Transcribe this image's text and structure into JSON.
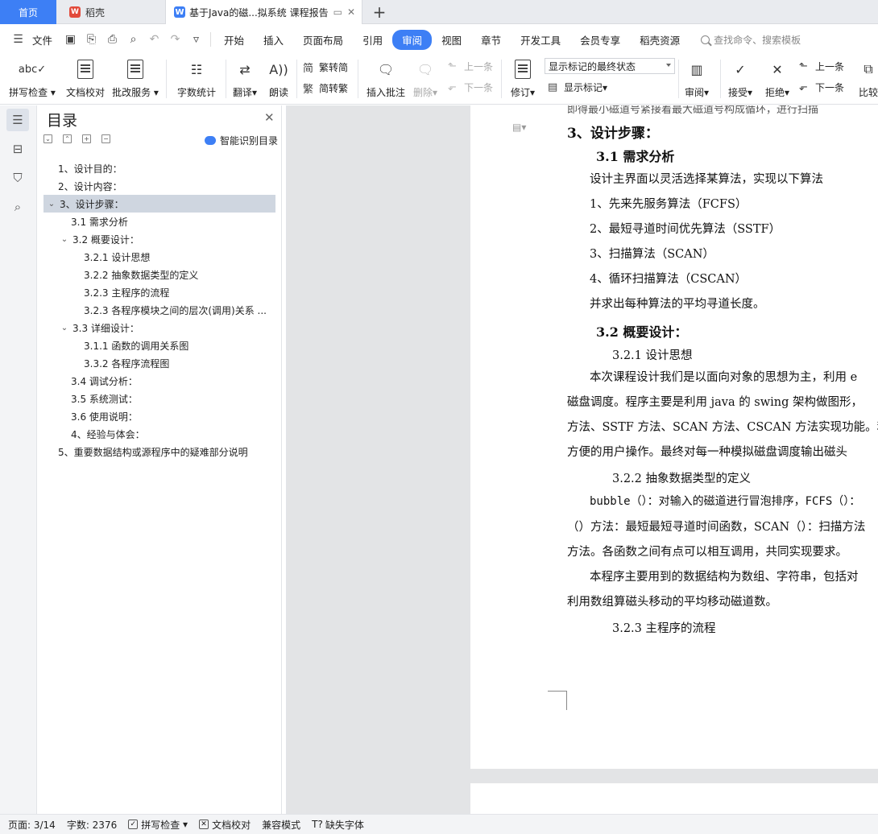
{
  "tabs": {
    "home": "首页",
    "daoke": "稻壳",
    "doc": "基于Java的磁...拟系统 课程报告",
    "add": "+"
  },
  "menu": {
    "file": "文件",
    "items": [
      "开始",
      "插入",
      "页面布局",
      "引用",
      "审阅",
      "视图",
      "章节",
      "开发工具",
      "会员专享",
      "稻壳资源"
    ],
    "active": "审阅",
    "search_placeholder": "查找命令、搜索模板"
  },
  "ribbon": {
    "spell_check": "拼写检查",
    "doc_proof": "文档校对",
    "batch_service": "批改服务",
    "word_count": "字数统计",
    "translate": "翻译",
    "read_aloud": "朗读",
    "to_traditional": "繁转简",
    "to_simplified": "简转繁",
    "insert_comment": "插入批注",
    "delete": "删除",
    "prev_comment": "上一条",
    "next_comment": "下一条",
    "revise": "修订",
    "markup_view": "显示标记的最终状态",
    "show_markup": "显示标记",
    "review": "审阅",
    "accept": "接受",
    "reject": "拒绝",
    "prev_change": "上一条",
    "next_change": "下一条",
    "compare": "比较"
  },
  "toc": {
    "title": "目录",
    "smart": "智能识别目录",
    "items": [
      {
        "label": "1、设计目的：",
        "level": 1,
        "expander": false
      },
      {
        "label": "2、设计内容：",
        "level": 1,
        "expander": false
      },
      {
        "label": "3、设计步骤：",
        "level": 1,
        "expander": true,
        "selected": true
      },
      {
        "label": "3.1 需求分析",
        "level": 2,
        "expander": false
      },
      {
        "label": "3.2  概要设计：",
        "level": 2,
        "expander": true
      },
      {
        "label": "3.2.1  设计思想",
        "level": 3,
        "expander": false
      },
      {
        "label": "3.2.2  抽象数据类型的定义",
        "level": 3,
        "expander": false
      },
      {
        "label": "3.2.3  主程序的流程",
        "level": 3,
        "expander": false
      },
      {
        "label": "3.2.3  各程序模块之间的层次(调用)关系 ...",
        "level": 3,
        "expander": false
      },
      {
        "label": "3.3 详细设计：",
        "level": 2,
        "expander": true
      },
      {
        "label": "3.1.1  函数的调用关系图",
        "level": 3,
        "expander": false
      },
      {
        "label": "3.3.2 各程序流程图",
        "level": 3,
        "expander": false
      },
      {
        "label": "3.4 调试分析：",
        "level": 2,
        "expander": false
      },
      {
        "label": "3.5  系统测试：",
        "level": 2,
        "expander": false
      },
      {
        "label": "3.6  使用说明：",
        "level": 2,
        "expander": false
      },
      {
        "label": "4、经验与体会：",
        "level": 2,
        "expander": false
      },
      {
        "label": "5、重要数据结构或源程序中的疑难部分说明",
        "level": 1,
        "expander": false
      }
    ]
  },
  "document": {
    "cut_line": "即得最小磁道号紧接着最大磁道号构成循环，进行扫描",
    "lines": [
      {
        "text": "3、设计步骤：",
        "style": "h1"
      },
      {
        "text": "3.1 需求分析",
        "style": "h2"
      },
      {
        "text": "设计主界面以灵活选择某算法，实现以下算法",
        "style": "p"
      },
      {
        "text": "1、先来先服务算法（FCFS）",
        "style": "p"
      },
      {
        "text": "2、最短寻道时间优先算法（SSTF）",
        "style": "p"
      },
      {
        "text": "3、扫描算法（SCAN）",
        "style": "p"
      },
      {
        "text": "4、循环扫描算法（CSCAN）",
        "style": "p"
      },
      {
        "text": "并求出每种算法的平均寻道长度。",
        "style": "p"
      },
      {
        "text": "3.2 概要设计：",
        "style": "h2"
      },
      {
        "text": "3.2.1 设计思想",
        "style": "h3"
      },
      {
        "text": "本次课程设计我们是以面向对象的思想为主，利用 e",
        "style": "p"
      },
      {
        "text": "磁盘调度。程序主要是利用 java 的 swing 架构做图形，",
        "style": "p"
      },
      {
        "text": "方法、SSTF 方法、SCAN 方法、CSCAN 方法实现功能。利",
        "style": "p"
      },
      {
        "text": "方便的用户操作。最终对每一种模拟磁盘调度输出磁头",
        "style": "p"
      },
      {
        "text": "3.2.2 抽象数据类型的定义",
        "style": "h3"
      },
      {
        "text": "bubble（）：对输入的磁道进行冒泡排序，FCFS（）：",
        "style": "mono"
      },
      {
        "text": "（）方法：最短最短寻道时间函数，SCAN（）：扫描方法",
        "style": "p"
      },
      {
        "text": "方法。各函数之间有点可以相互调用，共同实现要求。",
        "style": "p"
      },
      {
        "text": "本程序主要用到的数据结构为数组、字符串，包括对",
        "style": "p"
      },
      {
        "text": "利用数组算磁头移动的平均移动磁道数。",
        "style": "p"
      },
      {
        "text": "3.2.3 主程序的流程",
        "style": "h3"
      }
    ]
  },
  "status": {
    "page": "页面: 3/14",
    "words": "字数: 2376",
    "spell": "拼写检查",
    "proof": "文档校对",
    "compat": "兼容模式",
    "missing_font": "缺失字体"
  }
}
